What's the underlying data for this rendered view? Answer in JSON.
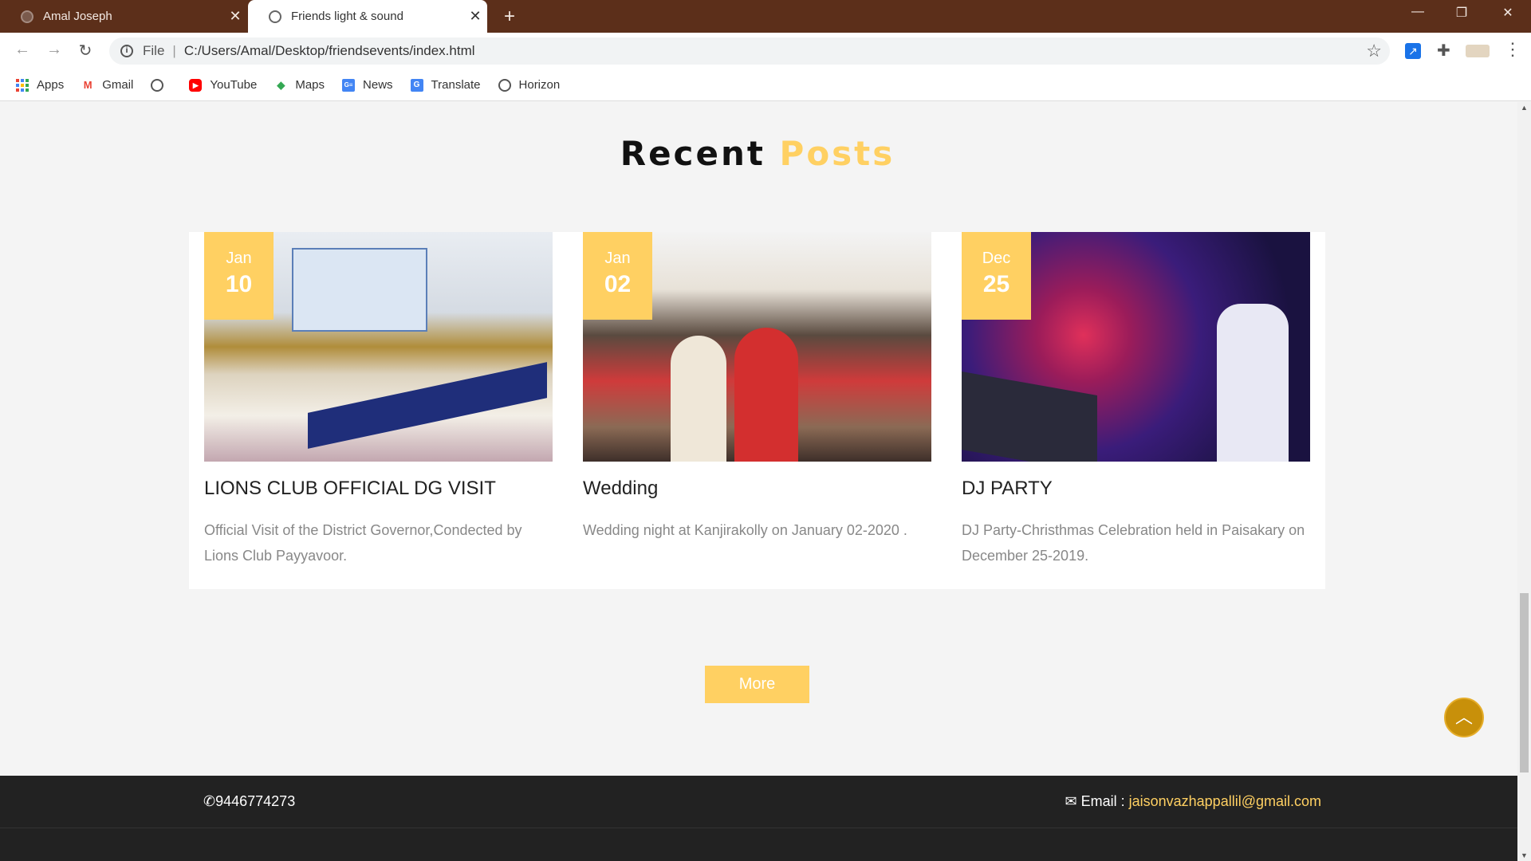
{
  "browser": {
    "tabs": [
      {
        "title": "Amal Joseph",
        "active": false
      },
      {
        "title": "Friends light & sound",
        "active": true
      }
    ],
    "address": {
      "scheme_label": "File",
      "url": "C:/Users/Amal/Desktop/friendsevents/index.html"
    },
    "bookmarks": [
      {
        "label": "Apps",
        "icon": "apps-grid-icon"
      },
      {
        "label": "Gmail",
        "icon": "gmail-icon"
      },
      {
        "label": "",
        "icon": "globe-icon"
      },
      {
        "label": "YouTube",
        "icon": "youtube-icon"
      },
      {
        "label": "Maps",
        "icon": "maps-icon"
      },
      {
        "label": "News",
        "icon": "news-icon"
      },
      {
        "label": "Translate",
        "icon": "translate-icon"
      },
      {
        "label": "Horizon",
        "icon": "globe-icon"
      }
    ]
  },
  "section": {
    "title_part1": "Recent",
    "title_part2": "Posts"
  },
  "posts": [
    {
      "month": "Jan",
      "day": "10",
      "title": "LIONS CLUB OFFICIAL DG VISIT",
      "excerpt": "Official Visit of the District Governor,Condected by Lions Club Payyavoor."
    },
    {
      "month": "Jan",
      "day": "02",
      "title": "Wedding",
      "excerpt": "Wedding night at Kanjirakolly on January 02-2020 ."
    },
    {
      "month": "Dec",
      "day": "25",
      "title": "DJ PARTY",
      "excerpt": "DJ Party-Christhmas Celebration held in Paisakary on December 25-2019."
    }
  ],
  "more_button": "More",
  "footer": {
    "phone": "9446774273",
    "email_label": "Email :",
    "email": "jaisonvazhappallil@gmail.com"
  },
  "colors": {
    "accent": "#ffd062",
    "footer_bg": "#222222",
    "tab_bar": "#5c2f1a",
    "scroll_top": "#c8900a"
  }
}
